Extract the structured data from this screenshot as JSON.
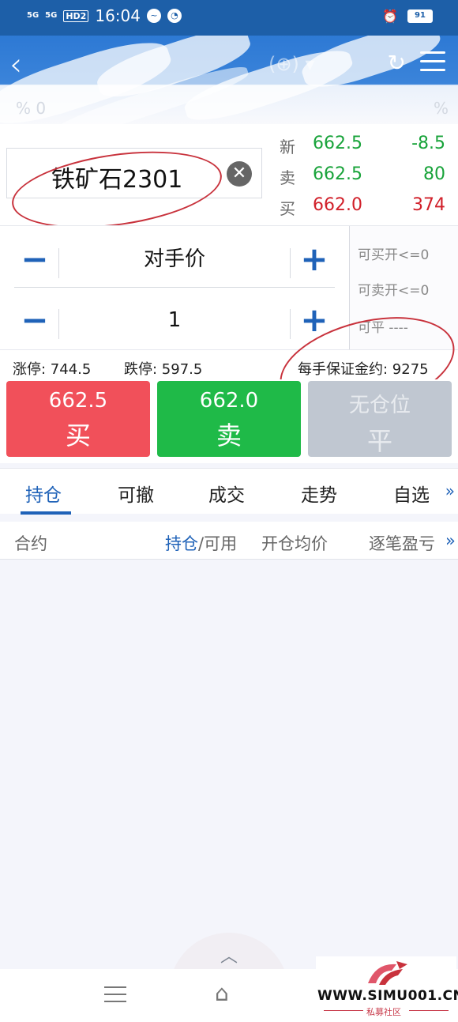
{
  "status_bar": {
    "signal1": "5G",
    "signal2": "5G",
    "hd": "HD2",
    "time": "16:04",
    "battery": "91"
  },
  "header": {
    "back_icon": "chevron-left-icon",
    "refresh_icon": "refresh-icon",
    "menu_icon": "menu-icon"
  },
  "symbol": {
    "name": "铁矿石2301",
    "clear_icon": "clear-icon"
  },
  "quotes": [
    {
      "label": "新",
      "price": "662.5",
      "value": "-8.5",
      "price_color": "#18a33a",
      "value_color": "#18a33a"
    },
    {
      "label": "卖",
      "price": "662.5",
      "value": "80",
      "price_color": "#18a33a",
      "value_color": "#18a33a"
    },
    {
      "label": "买",
      "price": "662.0",
      "value": "374",
      "price_color": "#d1202a",
      "value_color": "#d1202a"
    }
  ],
  "order": {
    "price_mode": "对手价",
    "quantity": "1",
    "can_buy_open": "可买开<=0",
    "can_sell_open": "可卖开<=0",
    "can_close": "可平 ----"
  },
  "limits": {
    "limit_up": "涨停: 744.5",
    "limit_down": "跌停: 597.5",
    "margin": "每手保证金约: 9275"
  },
  "actions": {
    "buy_price": "662.5",
    "buy_label": "买",
    "sell_price": "662.0",
    "sell_label": "卖",
    "close_status": "无仓位",
    "close_label": "平"
  },
  "tabs": [
    "持仓",
    "可撤",
    "成交",
    "走势",
    "自选"
  ],
  "tabs_more": "»",
  "table_header": {
    "col1": "合约",
    "col2_active": "持仓",
    "col2_rest": "/可用",
    "col3": "开仓均价",
    "col4": "逐笔盈亏",
    "more": "»"
  },
  "watermark": {
    "url": "WWW.SIMU001.CN",
    "sub": "私募社区"
  },
  "colors": {
    "brand_blue": "#1f62b8",
    "buy_red": "#f1505a",
    "sell_green": "#1fba48",
    "disabled_gray": "#c0c7d1"
  }
}
